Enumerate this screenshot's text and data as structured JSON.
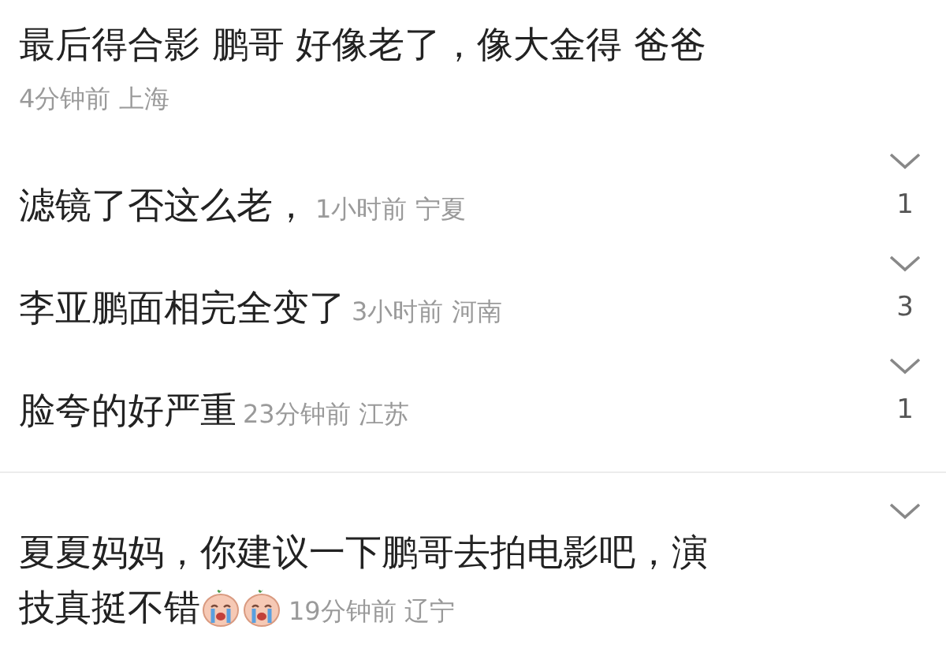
{
  "comments": [
    {
      "kind": "stacked",
      "lines": [
        "最后得合影 鹏哥 好像老了，像大金得 爸爸"
      ],
      "time": "4分钟前",
      "location": "上海"
    },
    {
      "kind": "inline",
      "lines": [
        "滤镜了否这么老，"
      ],
      "time": "1小时前",
      "location": "宁夏",
      "dislikes": "1"
    },
    {
      "kind": "inline",
      "lines": [
        "李亚鹏面相完全变了"
      ],
      "time": "3小时前",
      "location": "河南",
      "dislikes": "3"
    },
    {
      "kind": "inline",
      "lines": [
        "脸夸的好严重"
      ],
      "time": "23分钟前",
      "location": "江苏",
      "dislikes": "1"
    },
    {
      "kind": "inline",
      "divider_above": true,
      "lines": [
        "夏夏妈妈，你建议一下鹏哥去拍电影吧，演",
        "技真挺不错"
      ],
      "time": "19分钟前",
      "location": "辽宁",
      "emojis": [
        {
          "kind": "crying"
        },
        {
          "kind": "crying"
        }
      ]
    }
  ]
}
